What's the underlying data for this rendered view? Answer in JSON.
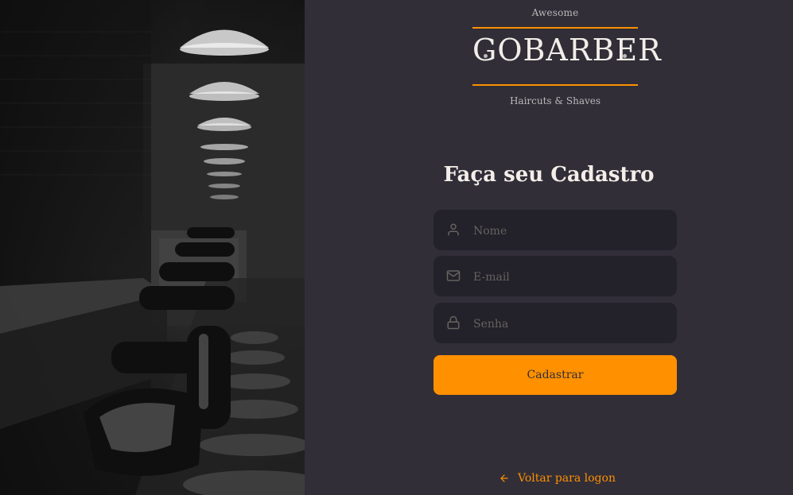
{
  "brand": {
    "top": "Awesome",
    "name": "GOBARBER",
    "tagline": "Haircuts & Shaves"
  },
  "form": {
    "title": "Faça seu Cadastro",
    "fields": {
      "name": {
        "placeholder": "Nome",
        "icon": "user-icon"
      },
      "email": {
        "placeholder": "E-mail",
        "icon": "mail-icon"
      },
      "password": {
        "placeholder": "Senha",
        "icon": "lock-icon"
      }
    },
    "submit_label": "Cadastrar"
  },
  "links": {
    "back_to_logon": "Voltar para logon"
  },
  "colors": {
    "accent": "#ff9000",
    "background": "#312e38",
    "input_background": "#232129",
    "placeholder": "#666360",
    "text": "#f4ede8"
  }
}
